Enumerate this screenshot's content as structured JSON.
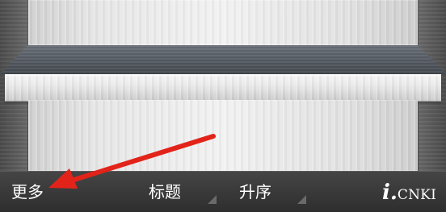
{
  "toolbar": {
    "more_label": "更多",
    "title_label": "标题",
    "order_label": "升序"
  },
  "brand": {
    "logo_parts": {
      "i": "i.",
      "name": "CNKI"
    }
  },
  "colors": {
    "annotation_arrow": "#e2231a",
    "toolbar_text": "#ffffff"
  },
  "icons": {
    "title_dropdown": "dropdown-triangle-icon",
    "order_dropdown": "dropdown-triangle-icon",
    "annotation": "arrow-icon"
  }
}
